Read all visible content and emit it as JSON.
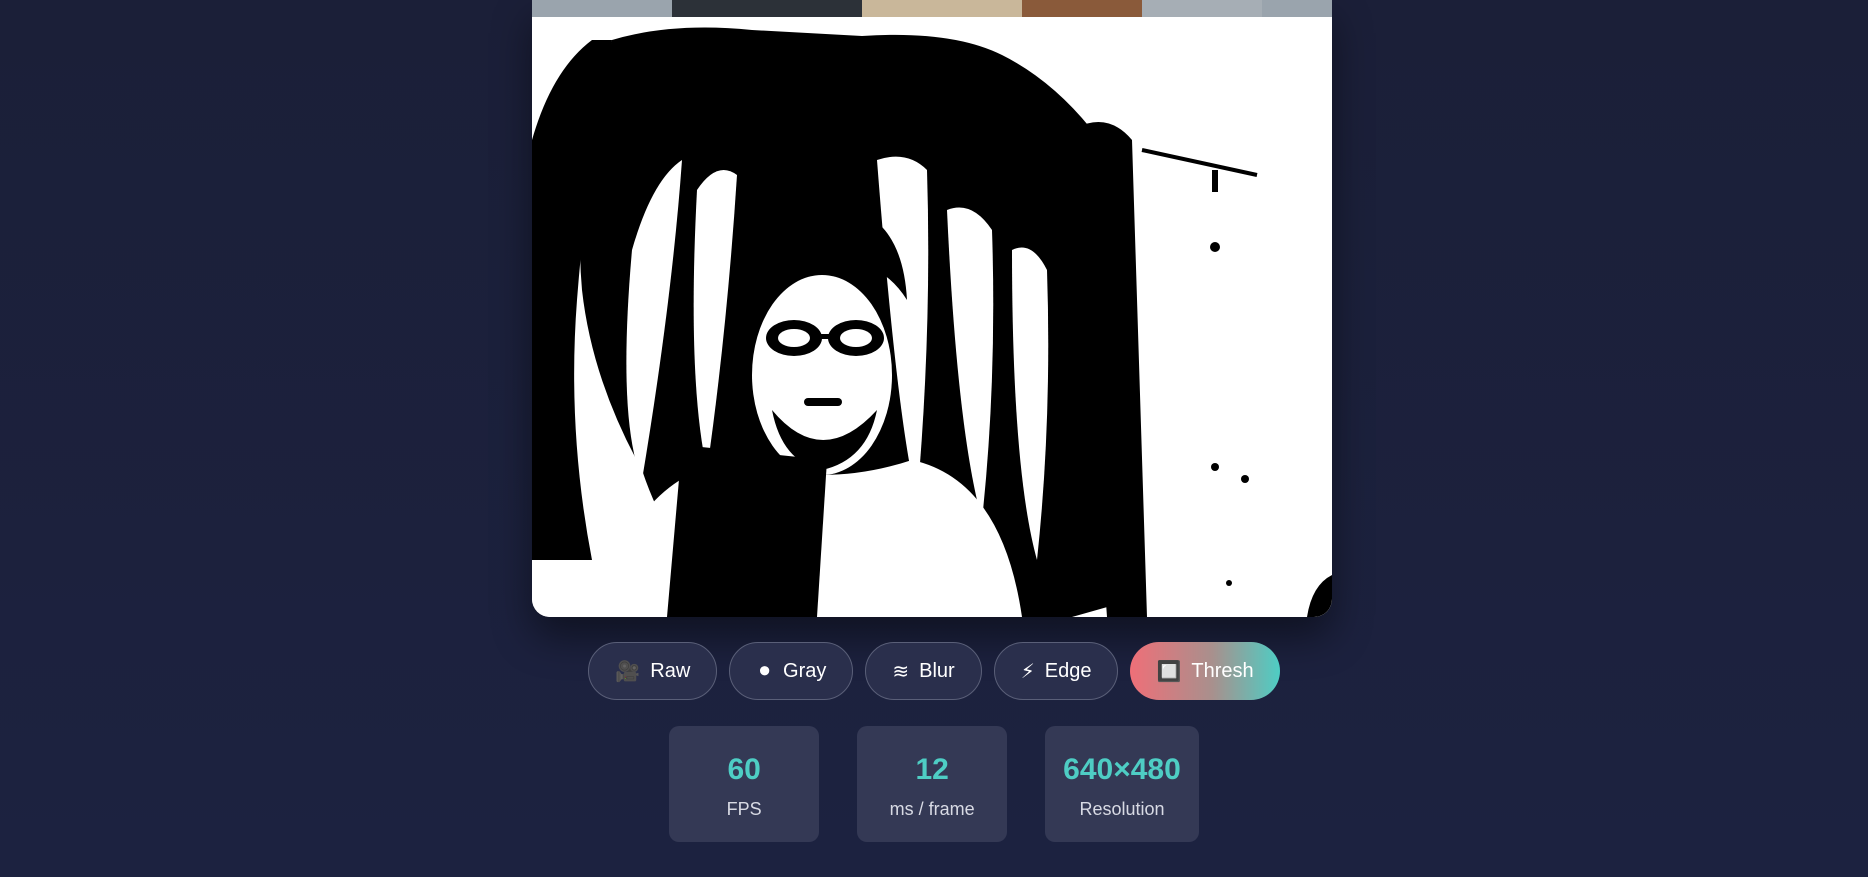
{
  "filters": [
    {
      "label": "Raw",
      "icon": "🎥",
      "icon_name": "video-camera-icon",
      "active": false
    },
    {
      "label": "Gray",
      "icon": "⚫",
      "icon_name": "circle-icon",
      "active": false
    },
    {
      "label": "Blur",
      "icon": "≋",
      "icon_name": "waves-icon",
      "active": false
    },
    {
      "label": "Edge",
      "icon": "⚡",
      "icon_name": "lightning-icon",
      "active": false
    },
    {
      "label": "Thresh",
      "icon": "🔲",
      "icon_name": "square-icon",
      "active": true
    }
  ],
  "stats": [
    {
      "value": "60",
      "label": "FPS"
    },
    {
      "value": "12",
      "label": "ms / frame"
    },
    {
      "value": "640×480",
      "label": "Resolution"
    }
  ],
  "colors": {
    "background": "#1b1f38",
    "accent": "#4ecdc4",
    "active_gradient_start": "#ef6f78",
    "active_gradient_end": "#4ecdc4"
  }
}
